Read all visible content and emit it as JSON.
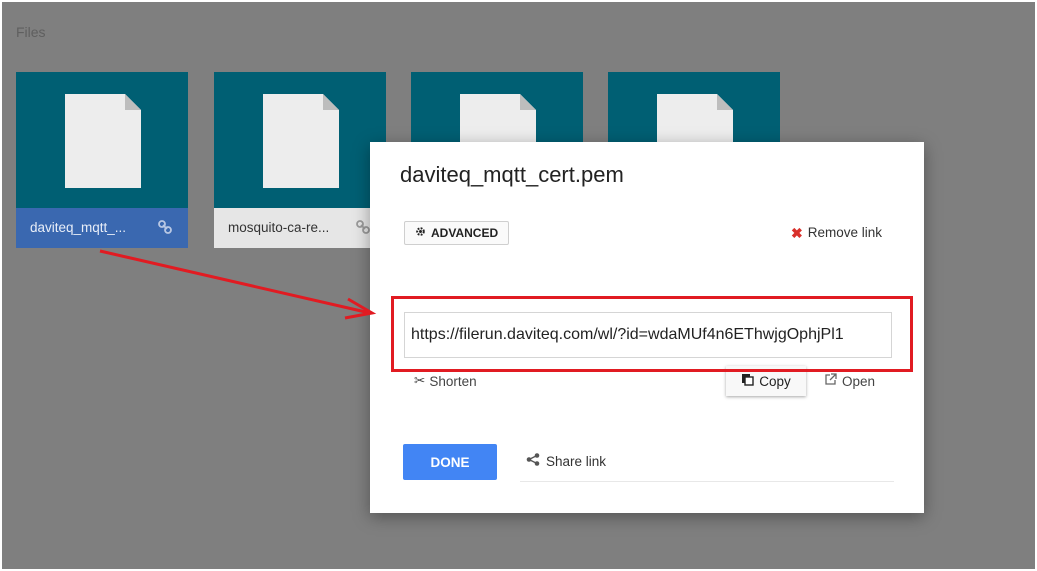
{
  "section": {
    "title": "Files"
  },
  "files": [
    {
      "name": "daviteq_mqtt_...",
      "selected": true,
      "shared": true
    },
    {
      "name": "mosquito-ca-re...",
      "selected": false,
      "shared": true
    },
    {
      "name": "",
      "selected": false,
      "shared": false
    },
    {
      "name": "",
      "selected": false,
      "shared": false
    }
  ],
  "dialog": {
    "title": "daviteq_mqtt_cert.pem",
    "advanced_label": "ADVANCED",
    "remove_link_label": "Remove link",
    "url_value": "https://filerun.daviteq.com/wl/?id=wdaMUf4n6EThwjgOphjPl1",
    "shorten_label": "Shorten",
    "copy_label": "Copy",
    "open_label": "Open",
    "done_label": "DONE",
    "share_link_label": "Share link"
  },
  "colors": {
    "tile": "#005f73",
    "selected_caption": "#3a68b0",
    "done_button": "#4285f4",
    "annotation": "#e11b22"
  },
  "icons": [
    "file-icon",
    "link-icon",
    "gear-icon",
    "close-icon",
    "scissors-icon",
    "copy-icon",
    "external-link-icon",
    "share-icon"
  ]
}
